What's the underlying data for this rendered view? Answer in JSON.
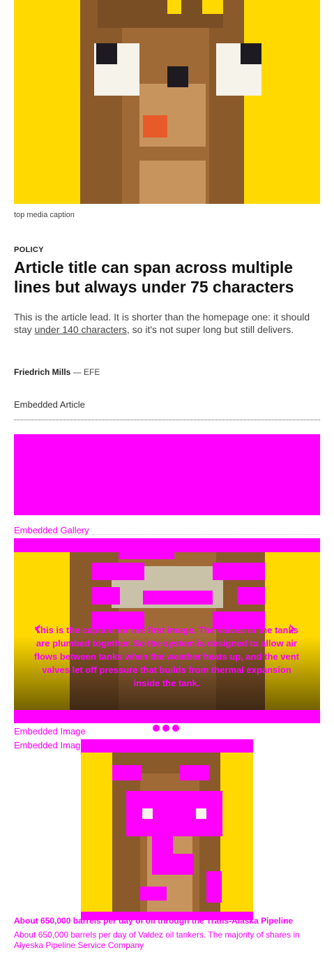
{
  "top_media": {
    "caption": "top media caption",
    "image_alt": "pixel art character"
  },
  "article": {
    "kicker": "POLICY",
    "title": "Article title can span across multiple lines but always under 75 characters",
    "lead_before": "This is the article lead. It is shorter than the homepage one: it should stay ",
    "lead_link": "under 140 characters",
    "lead_after": ", so it's not super long but still delivers.",
    "author": "Friedrich Mills",
    "agency_sep": " — ",
    "agency": "EFE"
  },
  "embeds": {
    "article_label": "Embedded Article",
    "gallery_label": "Embedded Gallery",
    "gallery_caption": "This is the caption for the first image. The valves of the tanks are plumbed together. So the system is designed to allow air flows between tanks when the weather heats up, and the vent valves let off pressure that builds from thermal expansion inside the tank.",
    "gallery_prev": "‹",
    "gallery_next": "›",
    "image_label_1": "Embedded Image",
    "image_label_2": "Embedded Image",
    "footer_text_1": "About 650,000 barrels per day of oil through the Trans-Alaska Pipeline",
    "footer_text_2": "About 650,000 barrels per day of Valdez oil tankers. The majority of shares in Alyeska Pipeline Service Company"
  },
  "colors": {
    "sky": "#ffd900",
    "fur_dark": "#8a5a2b",
    "fur_mid": "#a06a36",
    "fur_light": "#c8945e",
    "eye_white": "#f5f3ea",
    "eye_black": "#1e1a22",
    "nose": "#e85a2a",
    "placeholder": "#ff00ff"
  }
}
